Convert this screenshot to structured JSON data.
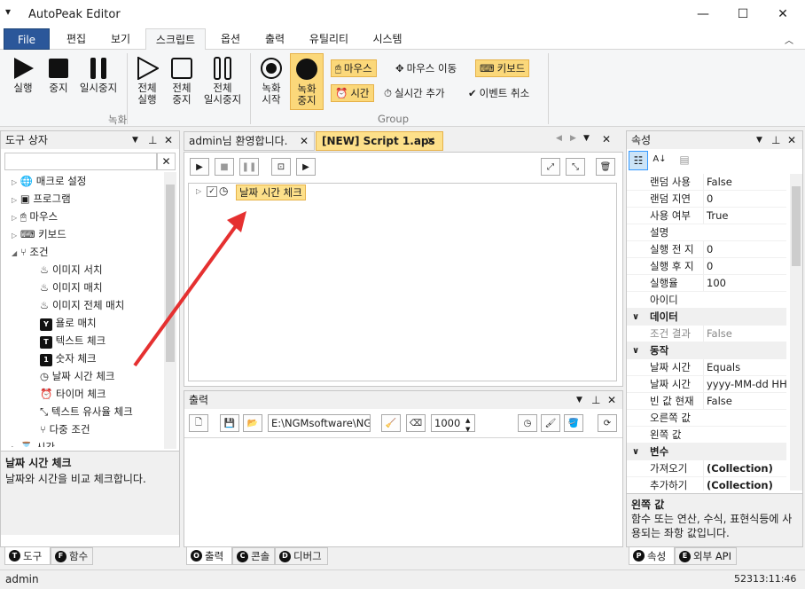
{
  "window": {
    "title": "AutoPeak Editor"
  },
  "menu": {
    "file": "File",
    "tabs": [
      "편집",
      "보기",
      "스크립트",
      "옵션",
      "출력",
      "유틸리티",
      "시스템"
    ]
  },
  "ribbon": {
    "run": "실행",
    "stop": "중지",
    "pause": "일시중지",
    "all_run_1": "전체",
    "all_run_2": "실행",
    "all_stop_1": "전체",
    "all_stop_2": "중지",
    "all_pause_1": "전체",
    "all_pause_2": "일시중지",
    "group_record": "녹화",
    "rec_start_1": "녹화",
    "rec_start_2": "시작",
    "rec_stop_1": "녹화",
    "rec_stop_2": "중지",
    "mouse": "마우스",
    "mouse_move": "마우스 이동",
    "keyboard": "키보드",
    "time": "시간",
    "realtime_add": "실시간 추가",
    "event_cancel": "이벤트 취소",
    "group_group": "Group"
  },
  "toolbox": {
    "title": "도구 상자",
    "items": [
      "매크로 설정",
      "프로그램",
      "마우스",
      "키보드",
      "조건",
      "이미지 서치",
      "이미지 매치",
      "이미지 전체 매치",
      "욜로 매치",
      "텍스트 체크",
      "숫자 체크",
      "날짜 시간 체크",
      "타이머 체크",
      "텍스트 유사율 체크",
      "다중 조건",
      "시간"
    ],
    "desc_title": "날짜 시간 체크",
    "desc_text": "날짜와 시간을 비교 체크합니다.",
    "tab_tools": "도구",
    "tab_func": "함수"
  },
  "editor": {
    "tab1": "admin님 환영합니다.",
    "tab2": "[NEW] Script 1.aps",
    "node_label": "날짜 시간 체크"
  },
  "output": {
    "title": "출력",
    "path": "E:\\NGMsoftware\\NG",
    "interval": "1000",
    "tab_output": "출력",
    "tab_console": "콘솔",
    "tab_debug": "디버그"
  },
  "properties": {
    "title": "속성",
    "rows": [
      {
        "type": "prop",
        "k": "랜덤 사용",
        "v": "False"
      },
      {
        "type": "prop",
        "k": "랜덤 지연",
        "v": "0"
      },
      {
        "type": "prop",
        "k": "사용 여부",
        "v": "True"
      },
      {
        "type": "prop",
        "k": "설명",
        "v": ""
      },
      {
        "type": "prop",
        "k": "실행 전 지",
        "v": "0"
      },
      {
        "type": "prop",
        "k": "실행 후 지",
        "v": "0"
      },
      {
        "type": "prop",
        "k": "실행율",
        "v": "100"
      },
      {
        "type": "prop",
        "k": "아이디",
        "v": ""
      },
      {
        "type": "cat",
        "k": "데이터"
      },
      {
        "type": "prop",
        "k": "조건 결과",
        "v": "False"
      },
      {
        "type": "cat",
        "k": "동작"
      },
      {
        "type": "prop",
        "k": "날짜 시간",
        "v": "Equals"
      },
      {
        "type": "prop",
        "k": "날짜 시간",
        "v": "yyyy-MM-dd HH:"
      },
      {
        "type": "prop",
        "k": "빈 값 현재",
        "v": "False"
      },
      {
        "type": "prop",
        "k": "오른쪽 값",
        "v": ""
      },
      {
        "type": "prop",
        "k": "왼쪽 값",
        "v": ""
      },
      {
        "type": "cat",
        "k": "변수"
      },
      {
        "type": "prop",
        "k": "가져오기",
        "v": "(Collection)"
      },
      {
        "type": "prop",
        "k": "추가하기",
        "v": "(Collection)"
      }
    ],
    "desc_title": "왼쪽 값",
    "desc_text": "함수 또는 연산, 수식, 표현식등에 사용되는 좌항 값입니다.",
    "tab_props": "속성",
    "tab_api": "외부 API"
  },
  "status": {
    "user": "admin",
    "clock": "52313:11:46"
  }
}
